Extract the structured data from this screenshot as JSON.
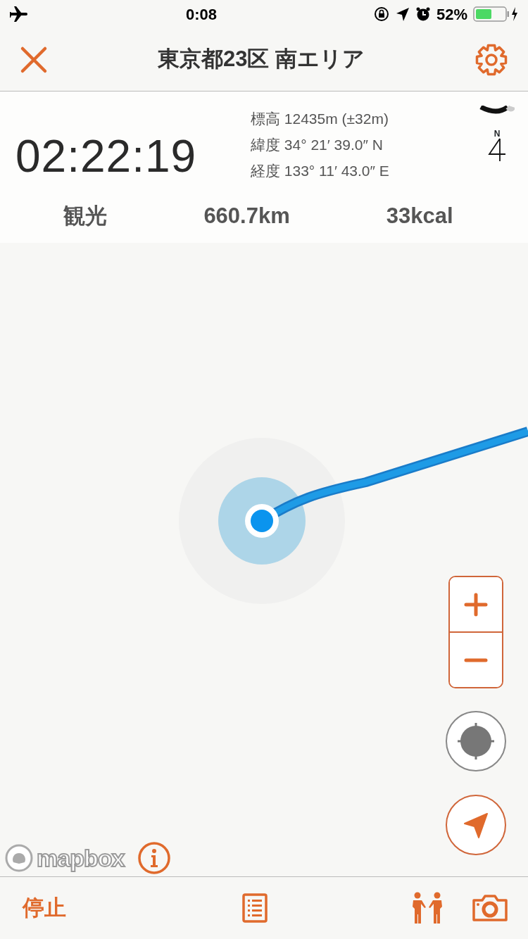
{
  "status_bar": {
    "time": "0:08",
    "battery_text": "52%"
  },
  "nav_bar": {
    "title": "東京都23区 南エリア"
  },
  "info_panel": {
    "elapsed": "02:22:19",
    "details": [
      {
        "label": "標高",
        "value": "12435m (±32m)"
      },
      {
        "label": "緯度",
        "value": "34° 21′ 39.0″ N"
      },
      {
        "label": "経度",
        "value": "133° 11′ 43.0″ E"
      }
    ],
    "compass_label": "N",
    "stats": [
      "観光",
      "660.7km",
      "33kcal"
    ]
  },
  "map": {
    "attribution": "mapbox"
  },
  "toolbar": {
    "stop_label": "停止"
  }
}
